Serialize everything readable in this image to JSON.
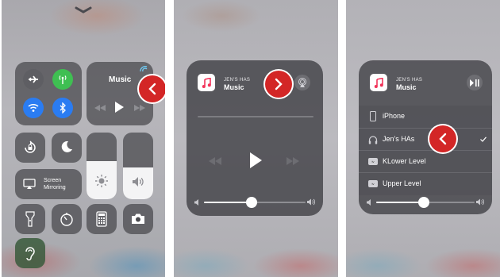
{
  "panel1": {
    "music_label": "Music",
    "screen_mirroring_line1": "Screen",
    "screen_mirroring_line2": "Mirroring"
  },
  "panel2": {
    "device_label": "JEN'S HAS",
    "song_label": "Music"
  },
  "panel3": {
    "device_label": "JEN'S HAS",
    "song_label": "Music",
    "outputs": [
      {
        "label": "iPhone",
        "icon": "iphone-icon",
        "selected": false
      },
      {
        "label": "Jen's HAs",
        "icon": "headphones-icon",
        "selected": true
      },
      {
        "label": "KLower Level",
        "icon": "appletv-icon",
        "selected": false
      },
      {
        "label": "Upper Level",
        "icon": "appletv-icon",
        "selected": false
      }
    ]
  },
  "colors": {
    "accent_red": "#d32626",
    "green": "#3fbf52",
    "blue": "#2a7cf2"
  }
}
